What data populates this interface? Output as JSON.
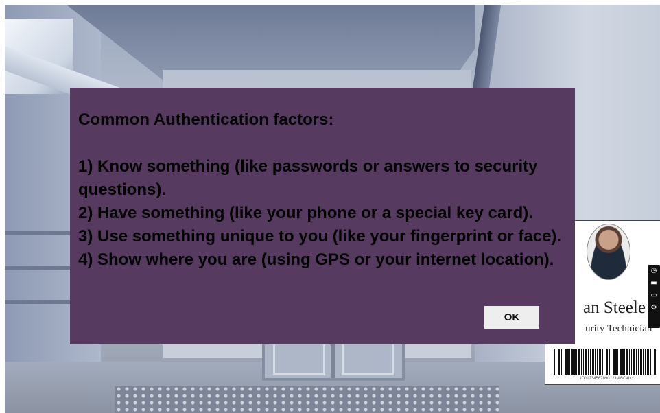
{
  "dialog": {
    "heading": "Common Authentication factors:",
    "lines": [
      "1) Know something (like passwords or answers to security questions).",
      "2) Have something (like your phone or a special key card).",
      "3) Use something unique to you (like your fingerprint or face).",
      "4) Show where you are (using GPS or your internet location)."
    ],
    "ok_label": "OK",
    "background_color": "#573a60"
  },
  "id_card": {
    "name": "an Steele",
    "title": "urity Technician",
    "barcode_text": "IO11234567890123 ABCabc"
  },
  "side_toolbar": {
    "icons": [
      "clock-icon",
      "display-icon",
      "window-icon",
      "gear-icon"
    ]
  }
}
